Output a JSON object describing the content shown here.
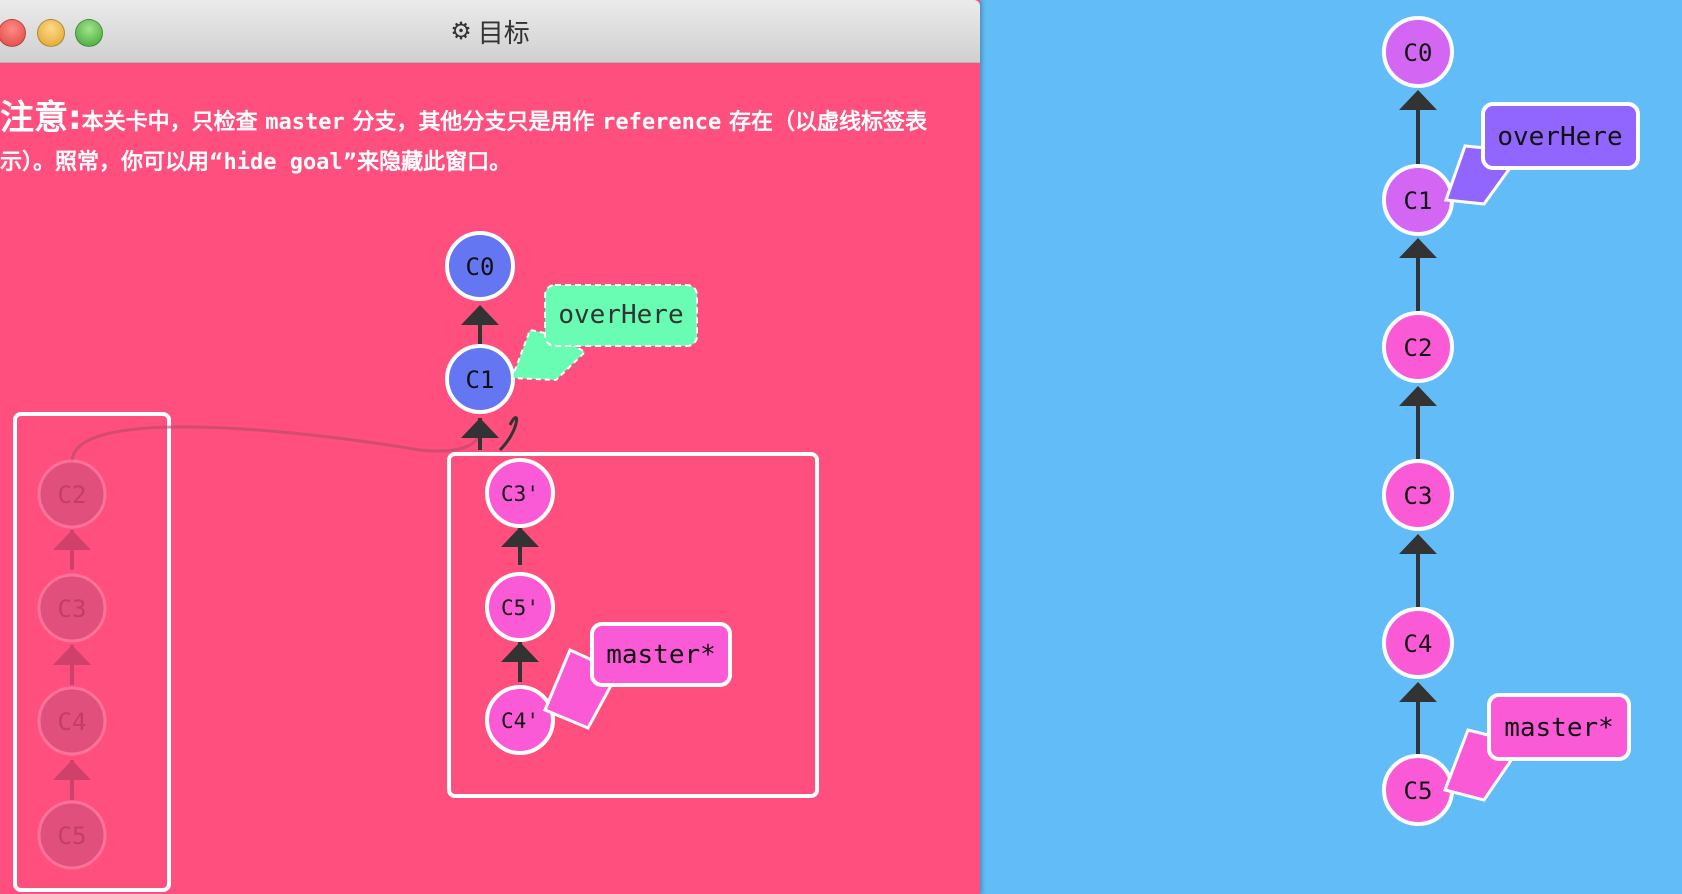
{
  "window": {
    "title": "目标",
    "icon": "gear-icon"
  },
  "notice": {
    "label": "注意:",
    "seg1": "本关卡中，只检查 ",
    "code1": "master",
    "seg2": " 分支，其他分支只是用作 ",
    "code2": "reference",
    "seg3": " 存在（以虚线标签表示）。照常，你可以用“",
    "code3": "hide goal",
    "seg4": "”来隐藏此窗口。"
  },
  "goal_tree": {
    "commits": {
      "c0": "C0",
      "c1": "C1",
      "c3p": "C3'",
      "c5p": "C5'",
      "c4p": "C4'"
    },
    "ghost_commits": {
      "c2": "C2",
      "c3": "C3",
      "c4": "C4",
      "c5": "C5"
    },
    "branches": {
      "overHere": "overHere",
      "master": "master*"
    }
  },
  "current_tree": {
    "commits": {
      "c0": "C0",
      "c1": "C1",
      "c2": "C2",
      "c3": "C3",
      "c4": "C4",
      "c5": "C5"
    },
    "branches": {
      "overHere": "overHere",
      "master": "master*"
    }
  },
  "colors": {
    "goal_background": "#fe4f7e",
    "visualization_background": "#62bcf8",
    "commit_blue": "#6476f2",
    "commit_pink": "#fb5ad7",
    "commit_purple": "#d466f4",
    "branch_green": "#68fdb2",
    "branch_purple": "#9166ff"
  }
}
